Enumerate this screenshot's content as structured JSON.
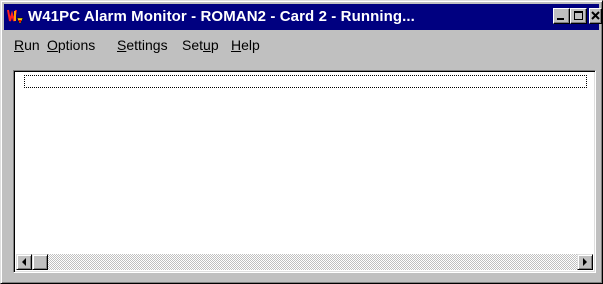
{
  "window": {
    "title": "W41PC Alarm Monitor - ROMAN2 - Card 2 - Running..."
  },
  "menu": [
    {
      "accel": "R",
      "rest": "un"
    },
    {
      "accel": "O",
      "rest": "ptions"
    },
    {
      "accel": "S",
      "rest": "ettings"
    },
    {
      "pre": "Set",
      "accel": "u",
      "rest": "p"
    },
    {
      "accel": "H",
      "rest": "elp"
    }
  ],
  "icons": {
    "app": "app-logo-icon",
    "minimize": "minimize-icon",
    "maximize": "maximize-icon",
    "close": "close-icon",
    "scroll_left": "arrow-left-icon",
    "scroll_right": "arrow-right-icon"
  },
  "colors": {
    "titlebar": "#000080",
    "face": "#c0c0c0",
    "list_background": "#ffffff"
  }
}
